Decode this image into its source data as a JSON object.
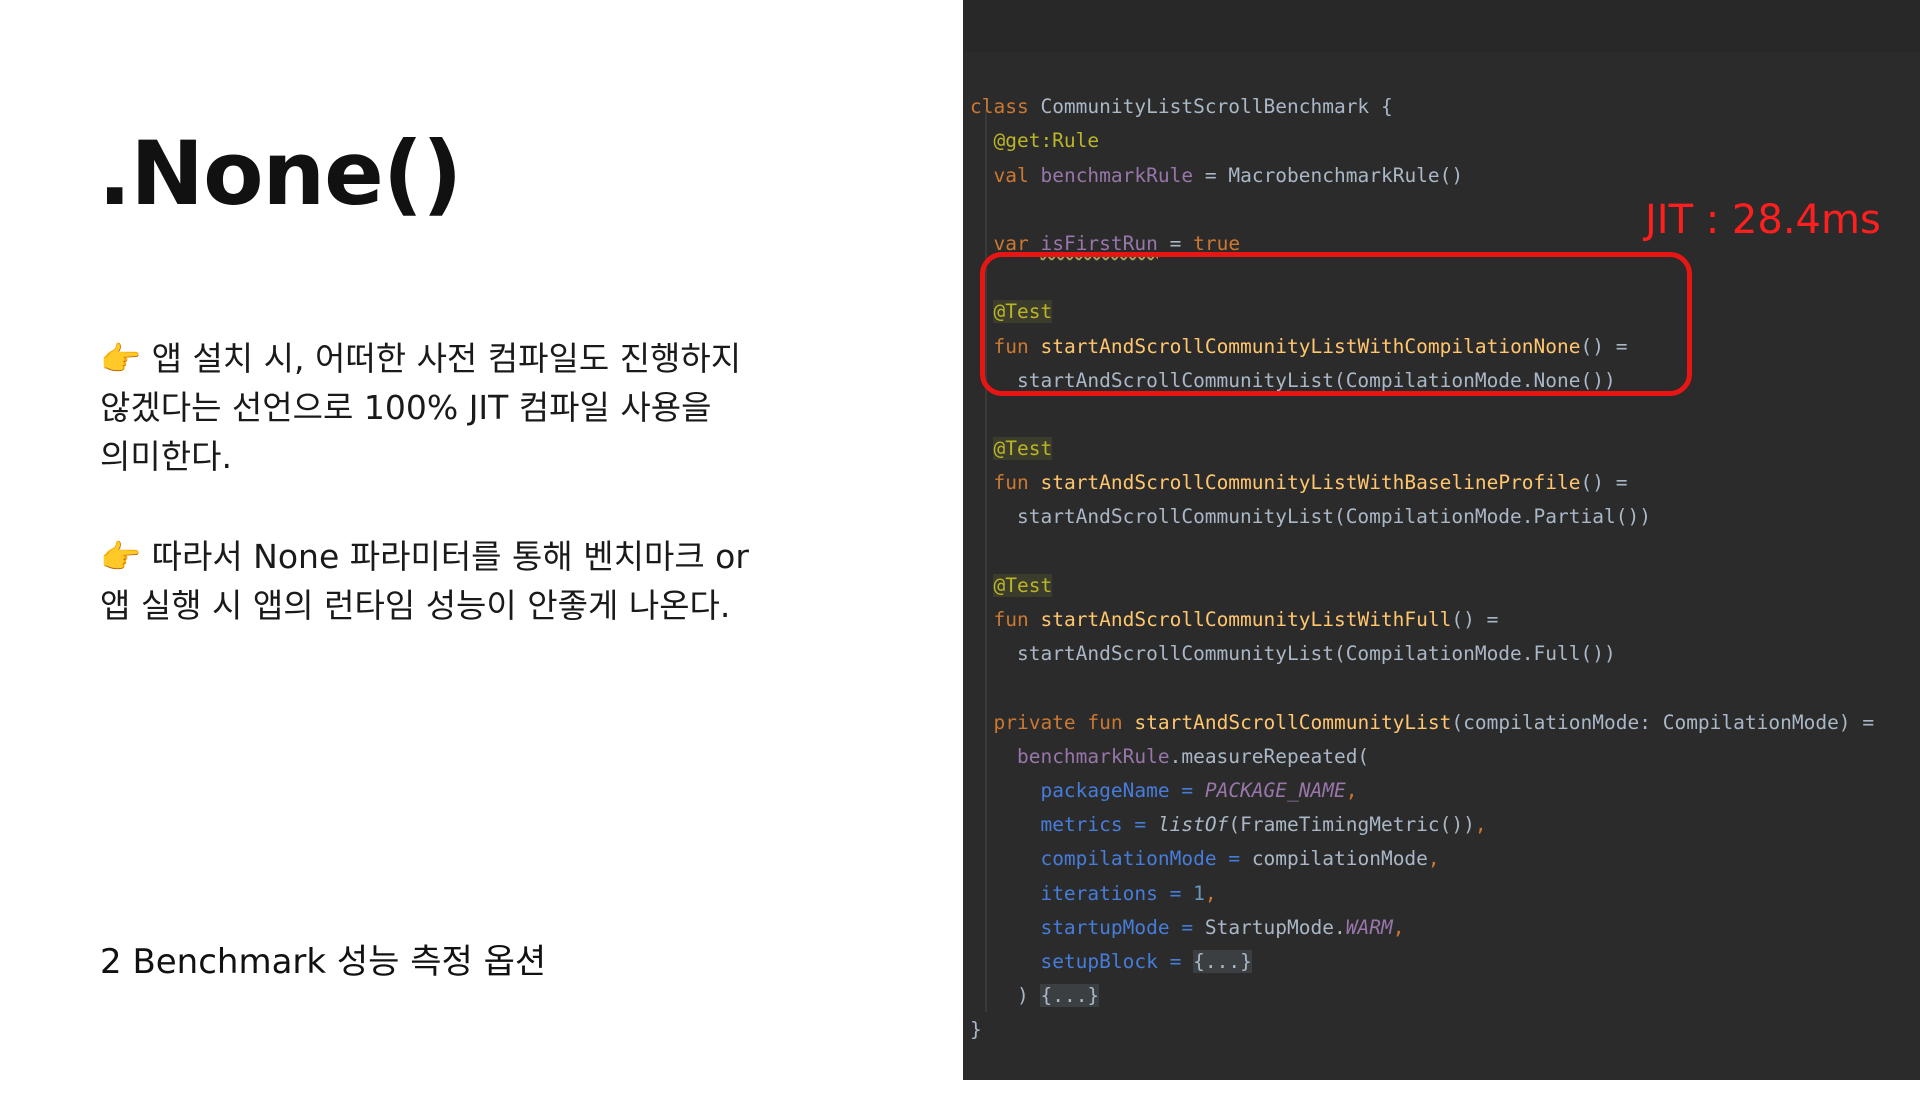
{
  "slide": {
    "title": ".None()",
    "paragraph1": {
      "icon": "pointing-hand-emoji",
      "emoji": "👉",
      "line1": "앱 설치 시, 어떠한 사전 컴파일도 진행하지",
      "line2": "않겠다는 선언으로 100% JIT 컴파일 사용을",
      "line3": "의미한다."
    },
    "paragraph2": {
      "icon": "pointing-hand-emoji",
      "emoji": "👉",
      "line1": "따라서 None 파라미터를 통해 벤치마크 or",
      "line2": "앱 실행 시 앱의 런타임 성능이 안좋게 나온다."
    },
    "footer": "2 Benchmark 성능 측정 옵션"
  },
  "annotation": {
    "label": "JIT : 28.4ms",
    "color": "#ff1f1f"
  },
  "code": {
    "class_kw": "class",
    "class_name": "CommunityListScrollBenchmark",
    "open_brace": "{",
    "rule_annotation": "@get:Rule",
    "val_kw": "val",
    "benchmark_rule": "benchmarkRule",
    "eq": "=",
    "rule_ctor": "MacrobenchmarkRule()",
    "var_kw": "var",
    "is_first_run": "isFirstRun",
    "true_kw": "true",
    "test_annotation": "@Test",
    "fun_kw": "fun",
    "fn_none": "startAndScrollCommunityListWithCompilationNone",
    "fn_baseline": "startAndScrollCommunityListWithBaselineProfile",
    "fn_full": "startAndScrollCommunityListWithFull",
    "parens": "()",
    "call_none": "startAndScrollCommunityList(CompilationMode.None())",
    "call_partial": "startAndScrollCommunityList(CompilationMode.Partial())",
    "call_full": "startAndScrollCommunityList(CompilationMode.Full())",
    "private_kw": "private",
    "fn_main": "startAndScrollCommunityList",
    "main_params": "(compilationMode: CompilationMode)",
    "benchmark_rule_ref": "benchmarkRule",
    "measure_call": ".measureRepeated(",
    "p_package_name": "packageName",
    "v_package_name": "PACKAGE_NAME",
    "p_metrics": "metrics",
    "v_list_of": "listOf",
    "v_metrics_arg": "(FrameTimingMetric())",
    "p_compilation_mode": "compilationMode",
    "v_compilation_mode": "compilationMode",
    "p_iterations": "iterations",
    "v_iterations": "1",
    "p_startup_mode": "startupMode",
    "v_startup_prefix": "StartupMode.",
    "v_startup_warm": "WARM",
    "p_setup_block": "setupBlock",
    "folded": "{...}",
    "close_paren": ")",
    "comma": ",",
    "close_brace": "}"
  }
}
